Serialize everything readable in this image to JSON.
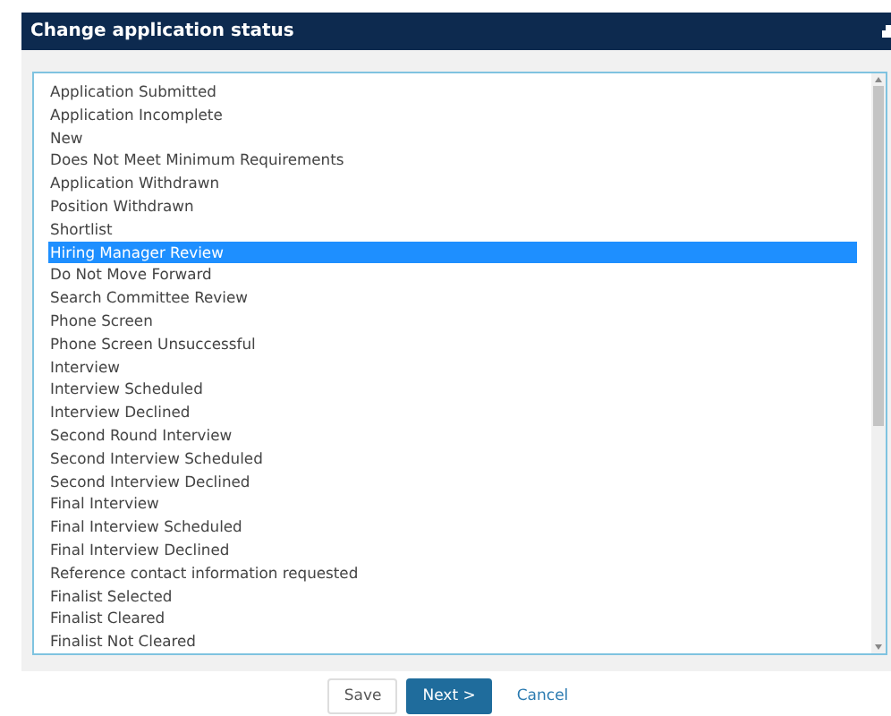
{
  "dialog": {
    "title": "Change application status"
  },
  "statuses": [
    {
      "label": "Application Submitted",
      "selected": false
    },
    {
      "label": "Application Incomplete",
      "selected": false
    },
    {
      "label": "New",
      "selected": false
    },
    {
      "label": "Does Not Meet Minimum Requirements",
      "selected": false
    },
    {
      "label": "Application Withdrawn",
      "selected": false
    },
    {
      "label": "Position Withdrawn",
      "selected": false
    },
    {
      "label": "Shortlist",
      "selected": false
    },
    {
      "label": "Hiring Manager Review",
      "selected": true
    },
    {
      "label": "Do Not Move Forward",
      "selected": false
    },
    {
      "label": "Search Committee Review",
      "selected": false
    },
    {
      "label": "Phone Screen",
      "selected": false
    },
    {
      "label": "Phone Screen Unsuccessful",
      "selected": false
    },
    {
      "label": "Interview",
      "selected": false
    },
    {
      "label": "Interview Scheduled",
      "selected": false
    },
    {
      "label": "Interview Declined",
      "selected": false
    },
    {
      "label": "Second Round Interview",
      "selected": false
    },
    {
      "label": "Second Interview Scheduled",
      "selected": false
    },
    {
      "label": "Second Interview Declined",
      "selected": false
    },
    {
      "label": "Final Interview",
      "selected": false
    },
    {
      "label": "Final Interview Scheduled",
      "selected": false
    },
    {
      "label": "Final Interview Declined",
      "selected": false
    },
    {
      "label": "Reference contact information requested",
      "selected": false
    },
    {
      "label": "Finalist Selected",
      "selected": false
    },
    {
      "label": "Finalist Cleared",
      "selected": false
    },
    {
      "label": "Finalist Not Cleared",
      "selected": false
    }
  ],
  "buttons": [
    {
      "label": "Save",
      "kind": "default"
    },
    {
      "label": "Next >",
      "kind": "primary"
    },
    {
      "label": "Cancel",
      "kind": "link"
    }
  ]
}
